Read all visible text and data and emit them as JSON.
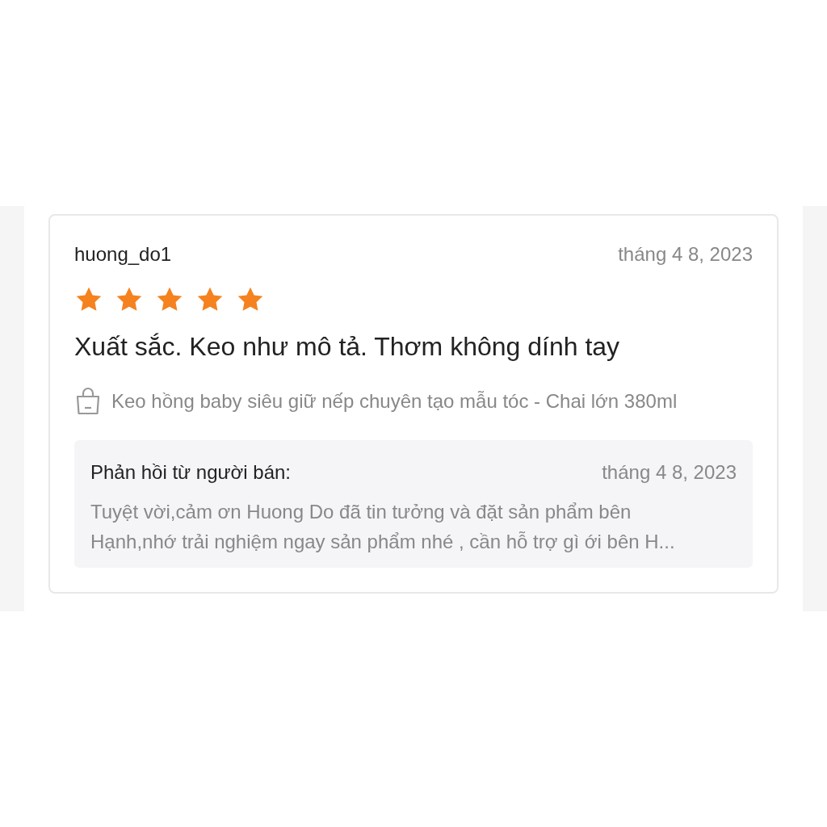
{
  "review": {
    "username": "huong_do1",
    "date": "tháng 4 8, 2023",
    "stars": 5,
    "title": "Xuất sắc. Keo như mô tả. Thơm không dính tay",
    "product": "Keo hồng baby siêu giữ nếp chuyên tạo mẫu tóc - Chai lớn 380ml"
  },
  "seller_reply": {
    "label": "Phản hồi từ người bán:",
    "date": "tháng 4 8, 2023",
    "lines": [
      "Tuyệt vời,cảm ơn Huong Do đã tin tưởng và đặt sản phẩm bên",
      "Hạnh,nhớ trải nghiệm ngay sản phẩm nhé , cần hỗ trợ gì ới bên H..."
    ]
  }
}
